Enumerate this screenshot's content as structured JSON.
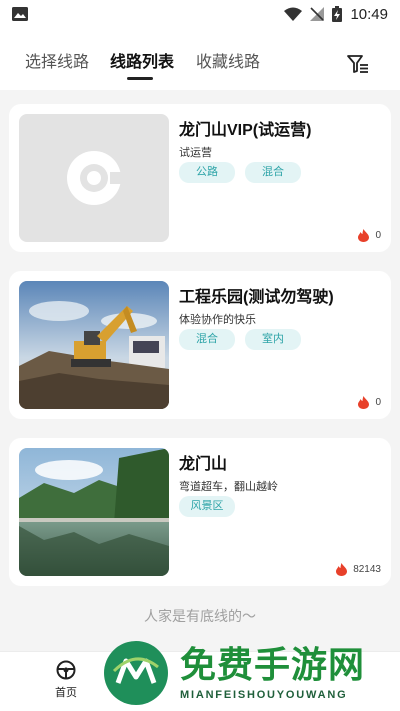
{
  "status_bar": {
    "time": "10:49",
    "icons": [
      "image-icon",
      "wifi-icon",
      "no-signal-icon",
      "battery-charging-icon"
    ]
  },
  "tabs": [
    {
      "label": "选择线路",
      "active": false
    },
    {
      "label": "线路列表",
      "active": true
    },
    {
      "label": "收藏线路",
      "active": false
    }
  ],
  "header_actions": {
    "filter_icon": "filter-icon"
  },
  "routes": [
    {
      "title": "龙门山VIP(试运营)",
      "subtitle": "试运营",
      "tags": [
        "公路",
        "混合"
      ],
      "heat": "0",
      "image": "placeholder-logo"
    },
    {
      "title": "工程乐园(测试勿驾驶)",
      "subtitle": "体验协作的快乐",
      "tags": [
        "混合",
        "室内"
      ],
      "heat": "0",
      "image": "excavator-photo"
    },
    {
      "title": "龙门山",
      "subtitle": "弯道超车，翻山越岭",
      "tags": [
        "风景区"
      ],
      "heat": "82143",
      "image": "lake-mountain-photo"
    }
  ],
  "footer_note": "人家是有底线的～",
  "bottom_nav": {
    "items": [
      {
        "label": "首页",
        "icon": "steering-wheel-icon"
      }
    ]
  },
  "watermark": {
    "title": "免费手游网",
    "subtitle": "MIANFEISHOUYOUWANG"
  },
  "colors": {
    "accent": "#2ea4a8",
    "tag_bg": "#e3f4f5",
    "heat_icon": "#e8402a",
    "watermark_green": "#1f8f3a"
  }
}
